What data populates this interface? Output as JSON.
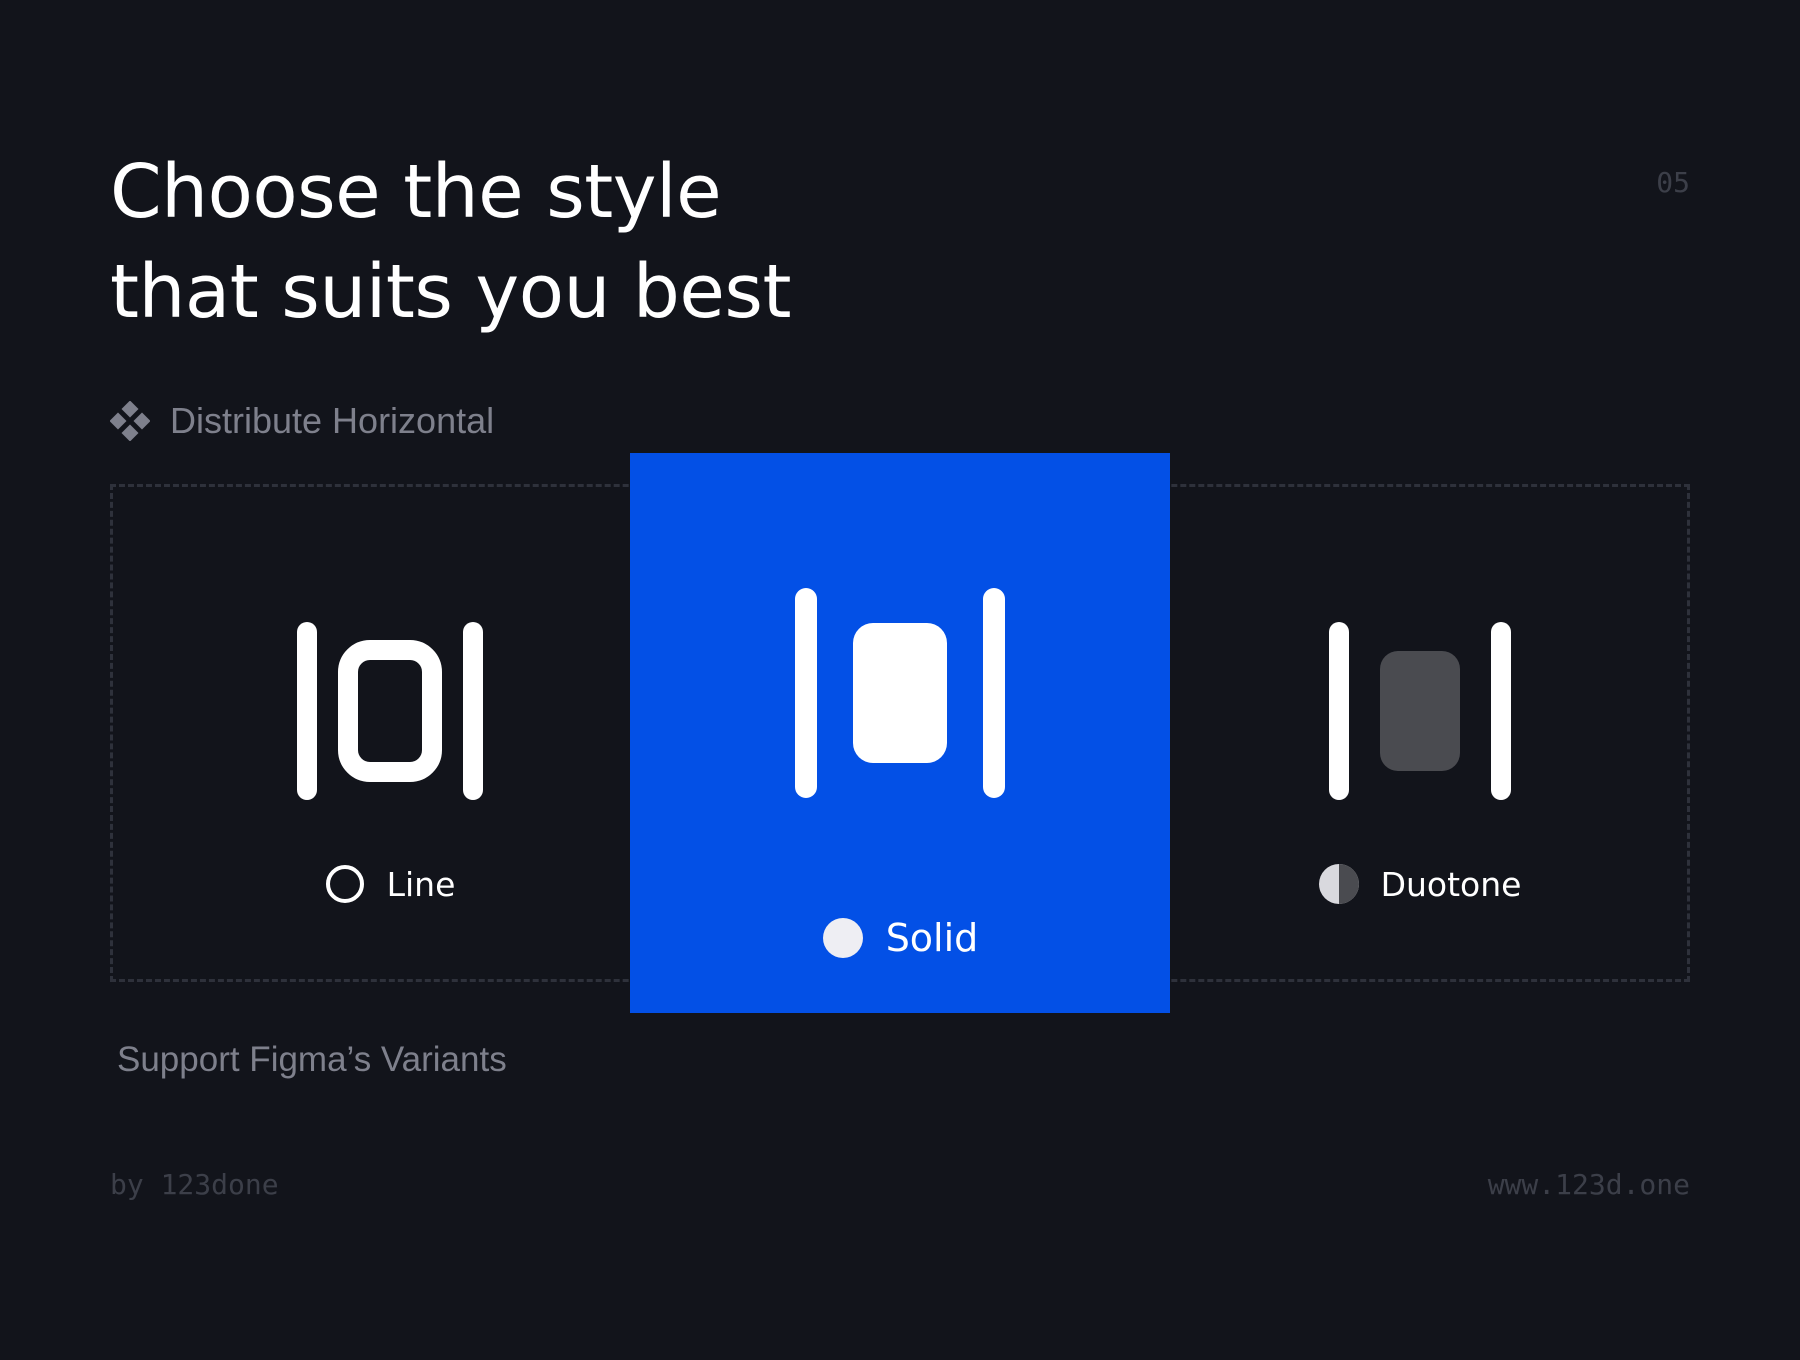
{
  "header": {
    "title_line_1": "Choose the style",
    "title_line_2": "that suits you best",
    "page_number": "05"
  },
  "component": {
    "icon": "figma-component-icon",
    "label": "Distribute Horizontal"
  },
  "variants": [
    {
      "label": "Line",
      "icon": "distribute-horizontal-line-icon",
      "indicator": "circle-outline-icon",
      "selected": false
    },
    {
      "label": "Solid",
      "icon": "distribute-horizontal-solid-icon",
      "indicator": "circle-filled-icon",
      "selected": true
    },
    {
      "label": "Duotone",
      "icon": "distribute-horizontal-duotone-icon",
      "indicator": "circle-half-icon",
      "selected": false
    }
  ],
  "support_text": "Support Figma’s Variants",
  "footer": {
    "author": "by 123done",
    "website": "www.123d.one"
  },
  "colors": {
    "background": "#12141b",
    "accent": "#0350e6",
    "muted_text": "#7e808c",
    "footer_text": "#3c3f49",
    "duotone_fill": "#4a4b50"
  }
}
